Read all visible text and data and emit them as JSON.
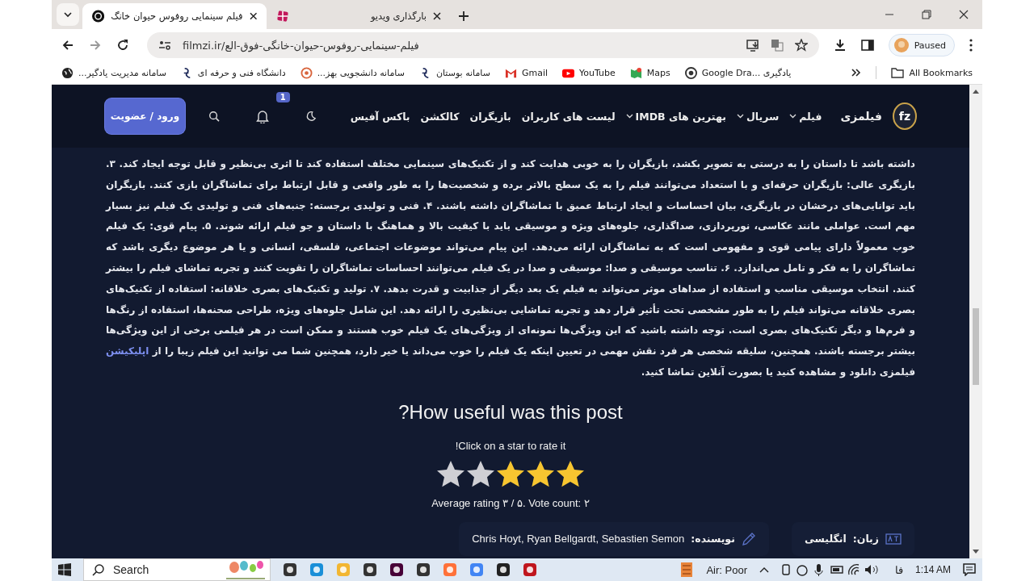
{
  "browser": {
    "tabs": [
      {
        "title": "بارگذاری ویدیو",
        "selected": false
      },
      {
        "title": "فیلم سینمایی روفوس حیوان خانگ",
        "selected": true
      }
    ],
    "address": "filmzi.ir/فیلم-سینمایی-روفوس-حیوان-خانگی-فوق-الع",
    "profile": "Paused",
    "bookmarks": [
      "Google Dra... یادگیری",
      "Maps",
      "YouTube",
      "Gmail",
      "سامانه بوستان",
      "سامانه دانشجویی بهز...",
      "دانشگاه فنی و حرفه ای",
      "سامانه مدیریت یادگیر..."
    ],
    "all_bookmarks": "All Bookmarks"
  },
  "site": {
    "logo": "fz",
    "name": "فیلمزی",
    "menu": [
      {
        "label": "فیلم",
        "has_submenu": true
      },
      {
        "label": "سریال",
        "has_submenu": true
      },
      {
        "label": "بهترین های IMDB",
        "has_submenu": true
      },
      {
        "label": "لیست های کاربران",
        "has_submenu": false
      },
      {
        "label": "بازیگران",
        "has_submenu": false
      },
      {
        "label": "کالکشن",
        "has_submenu": false
      },
      {
        "label": "باکس آفیس",
        "has_submenu": false
      }
    ],
    "notification_count": "1",
    "login_button": "ورود / عضویت"
  },
  "article": {
    "text": "داشته باشد تا داستان را به درستی به تصویر بکشد، بازیگران را به خوبی هدایت کند و از تکنیک‌های سینمایی مختلف استفاده کند تا اثری بی‌نظیر و قابل توجه ایجاد کند. ۳. بازیگری عالی: بازیگران حرفه‌ای و با استعداد می‌توانند فیلم را به یک سطح بالاتر برده و شخصیت‌ها را به طور واقعی و قابل ارتباط برای تماشاگران بازی کنند. بازیگران باید توانایی‌های درخشان در بازیگری، بیان احساسات و ایجاد ارتباط عمیق با تماشاگران داشته باشند. ۴. فنی و تولیدی برجسته: جنبه‌های فنی و تولیدی یک فیلم نیز بسیار مهم است. عواملی مانند عکاسی، نورپردازی، صداگذاری، جلوه‌های ویژه و موسیقی باید با کیفیت بالا و هماهنگ با داستان و جو فیلم ارائه شوند. ۵. پیام قوی: یک فیلم خوب معمولاً دارای پیامی قوی و مفهومی است که به تماشاگران ارائه می‌دهد. این پیام می‌تواند موضوعات اجتماعی، فلسفی، انسانی و یا هر موضوع دیگری باشد که تماشاگران را به فکر و تامل می‌اندازد. ۶. تناسب موسیقی و صدا: موسیقی و صدا در یک فیلم می‌توانند احساسات تماشاگران را تقویت کنند و تجربه تماشای فیلم را بیشتر کنند. انتخاب موسیقی مناسب و استفاده از صداهای موثر می‌تواند به فیلم یک بعد دیگر از جذابیت و قدرت بدهد. ۷. تولید و تکنیک‌های بصری خلاقانه: استفاده از تکنیک‌های بصری خلاقانه می‌تواند فیلم را به طور مشخصی تحت تأثیر قرار دهد و تجربه تماشایی بی‌نظیری را ارائه دهد. این شامل جلوه‌های ویژه، طراحی صحنه‌ها، استفاده از رنگ‌ها و فرم‌ها و دیگر تکنیک‌های بصری است. توجه داشته باشید که این ویژگی‌ها نمونه‌ای از ویژگی‌های یک فیلم خوب هستند و ممکن است در هر فیلمی برخی از این ویژگی‌ها بیشتر برجسته باشند. همچنین، سلیقه شخصی هر فرد نقش مهمی در تعیین اینکه یک فیلم را خوب می‌داند یا خیر دارد، همچنین شما می توانید این فیلم زیبا را از",
    "link": "اپلیکیشن",
    "text_after": "فیلمزی دانلود و مشاهده کنید یا بصورت آنلاین تماشا کنید."
  },
  "rating": {
    "title": "How useful was this post?",
    "prompt": "Click on a star to rate it!",
    "stars": 3,
    "summary": "Average rating ۳ / ۵. Vote count: ۲"
  },
  "details": [
    {
      "kind": "language",
      "label": "زبان:",
      "value": "انگلیسی"
    },
    {
      "kind": "writer",
      "label": "نویسنده:",
      "value": "Chris Hoyt, Ryan Bellgardt, Sebastien Semon"
    }
  ],
  "taskbar": {
    "search": "Search",
    "weather": "Air: Poor",
    "language": "فا",
    "time": "1:14 AM"
  }
}
